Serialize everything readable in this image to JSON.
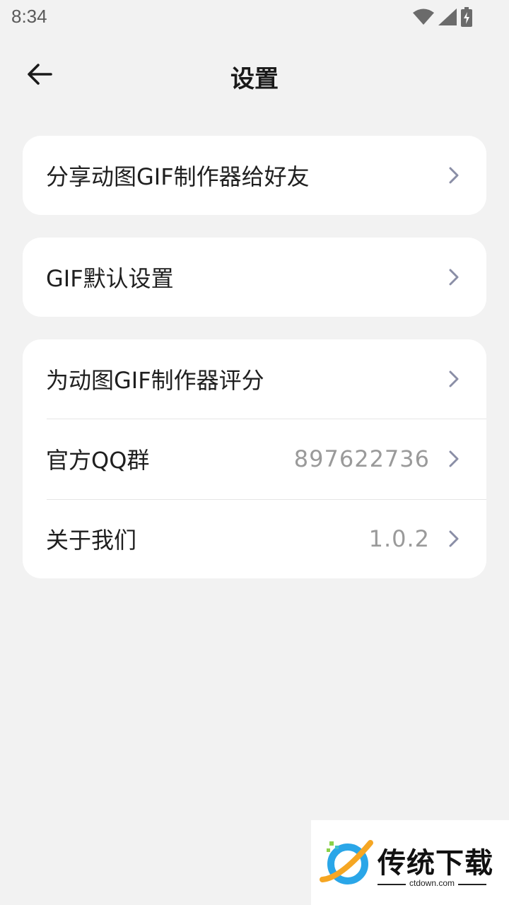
{
  "status_bar": {
    "time": "8:34",
    "icons": [
      "wifi-icon",
      "signal-icon",
      "battery-charging-icon"
    ]
  },
  "app_bar": {
    "back_icon": "arrow-left-icon",
    "title": "设置"
  },
  "cards": [
    {
      "rows": [
        {
          "label": "分享动图GIF制作器给好友",
          "value": ""
        }
      ]
    },
    {
      "rows": [
        {
          "label": "GIF默认设置",
          "value": ""
        }
      ]
    },
    {
      "rows": [
        {
          "label": "为动图GIF制作器评分",
          "value": ""
        },
        {
          "label": "官方QQ群",
          "value": "897622736"
        },
        {
          "label": "关于我们",
          "value": "1.0.2"
        }
      ]
    }
  ],
  "watermark": {
    "title": "传统下载",
    "subtitle": "ctdown.com"
  },
  "colors": {
    "background": "#f2f2f2",
    "card": "#ffffff",
    "chevron": "#8a8ea6",
    "value_text": "#9a9a9a"
  }
}
